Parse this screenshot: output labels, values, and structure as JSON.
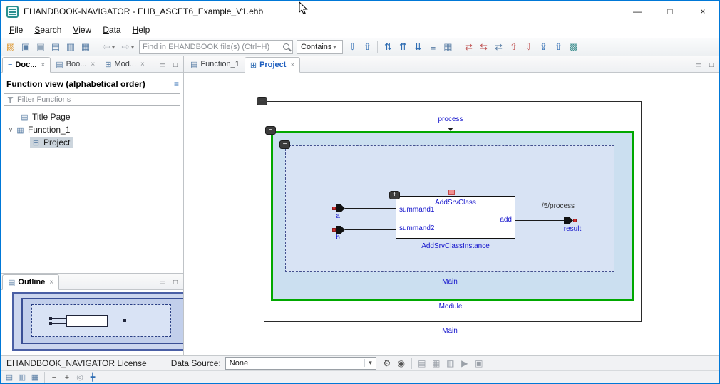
{
  "titlebar": {
    "title": "EHANDBOOK-NAVIGATOR - EHB_ASCET6_Example_V1.ehb",
    "minimize": "—",
    "maximize": "□",
    "close": "×"
  },
  "menu": {
    "items": [
      {
        "label": "File"
      },
      {
        "label": "Search"
      },
      {
        "label": "View"
      },
      {
        "label": "Data"
      },
      {
        "label": "Help"
      }
    ]
  },
  "toolbar": {
    "search_placeholder": "Find in EHANDBOOK file(s) (Ctrl+H)",
    "contains_label": "Contains",
    "caret": "▾",
    "icons": [
      {
        "name": "open-icon",
        "glyph": "▨"
      },
      {
        "name": "save-icon",
        "glyph": "▣"
      },
      {
        "name": "save-all-icon",
        "glyph": "▣"
      },
      {
        "name": "print-icon",
        "glyph": "▤"
      },
      {
        "name": "export-icon",
        "glyph": "▥"
      },
      {
        "name": "copy-icon",
        "glyph": "▦"
      },
      {
        "name": "back-icon",
        "glyph": "⇦"
      },
      {
        "name": "forward-icon",
        "glyph": "⇨"
      },
      {
        "name": "next-match-icon",
        "glyph": "⇩"
      },
      {
        "name": "prev-match-icon",
        "glyph": "⇧"
      },
      {
        "name": "link-editor-icon",
        "glyph": "⇅"
      },
      {
        "name": "collapse-all-icon",
        "glyph": "⇈"
      },
      {
        "name": "expand-all-icon",
        "glyph": "⇊"
      },
      {
        "name": "list-view-icon",
        "glyph": "≡"
      },
      {
        "name": "table-view-icon",
        "glyph": "▦"
      },
      {
        "name": "diff-prev-icon",
        "glyph": "⇄"
      },
      {
        "name": "diff-next-icon",
        "glyph": "⇆"
      },
      {
        "name": "diff-all-icon",
        "glyph": "⇄"
      },
      {
        "name": "prev-change-icon",
        "glyph": "⇧"
      },
      {
        "name": "next-change-icon",
        "glyph": "⇩"
      },
      {
        "name": "promote-icon",
        "glyph": "⇪"
      },
      {
        "name": "demote-icon",
        "glyph": "⇧"
      },
      {
        "name": "matrix-icon",
        "glyph": "▩"
      }
    ]
  },
  "panel": {
    "min": "▭",
    "max": "□"
  },
  "left_tabs": [
    {
      "label": "Doc...",
      "icon": "≡",
      "close": "×"
    },
    {
      "label": "Boo...",
      "icon": "▤",
      "close": "×"
    },
    {
      "label": "Mod...",
      "icon": "⊞",
      "close": "×"
    }
  ],
  "function_view": {
    "title": "Function view (alphabetical order)",
    "sort_icon": "≡",
    "filter_placeholder": "Filter Functions",
    "items": [
      {
        "label": "Title Page",
        "icon": "▤"
      },
      {
        "label": "Function_1",
        "icon": "▦",
        "expander": "∨"
      },
      {
        "label": "Project",
        "icon": "⊞"
      }
    ]
  },
  "outline": {
    "label": "Outline",
    "icon": "▤",
    "close": "×"
  },
  "editor_tabs": [
    {
      "label": "Function_1",
      "icon": "▤"
    },
    {
      "label": "Project",
      "icon": "⊞",
      "close": "×"
    }
  ],
  "diagram": {
    "collapse": "−",
    "expand": "+",
    "process": "process",
    "module": "Module",
    "inner_main": "Main",
    "outer_main": "Main",
    "block_class": "AddSrvClass",
    "block_instance": "AddSrvClassInstance",
    "input1": "summand1",
    "input2": "summand2",
    "output": "add",
    "port_a": "a",
    "port_b": "b",
    "result": "result",
    "path": "/5/process"
  },
  "statusbar": {
    "license": "EHANDBOOK_NAVIGATOR License",
    "datasource_label": "Data Source:",
    "datasource_value": "None",
    "caret": "▾",
    "icons": [
      {
        "name": "settings-icon",
        "glyph": "⚙"
      },
      {
        "name": "visibility-icon",
        "glyph": "◉"
      },
      {
        "name": "report-icon",
        "glyph": "▤"
      },
      {
        "name": "summary-icon",
        "glyph": "▦"
      },
      {
        "name": "export-table-icon",
        "glyph": "▥"
      },
      {
        "name": "run-icon",
        "glyph": "▶"
      },
      {
        "name": "stop-icon",
        "glyph": "▣"
      }
    ]
  },
  "bottombar": {
    "icons": [
      {
        "name": "layout-single-icon",
        "glyph": "▤"
      },
      {
        "name": "layout-split-icon",
        "glyph": "▥"
      },
      {
        "name": "layout-grid-icon",
        "glyph": "▦"
      },
      {
        "name": "zoom-out-icon",
        "glyph": "−"
      },
      {
        "name": "zoom-in-icon",
        "glyph": "+"
      },
      {
        "name": "probe-icon",
        "glyph": "◎"
      },
      {
        "name": "fit-screen-icon",
        "glyph": "╋"
      }
    ]
  },
  "colors": {
    "accent": "#0078d7",
    "module_border": "#00a800",
    "diagram_label": "#1414cc",
    "selection": "#ccd5dd"
  }
}
